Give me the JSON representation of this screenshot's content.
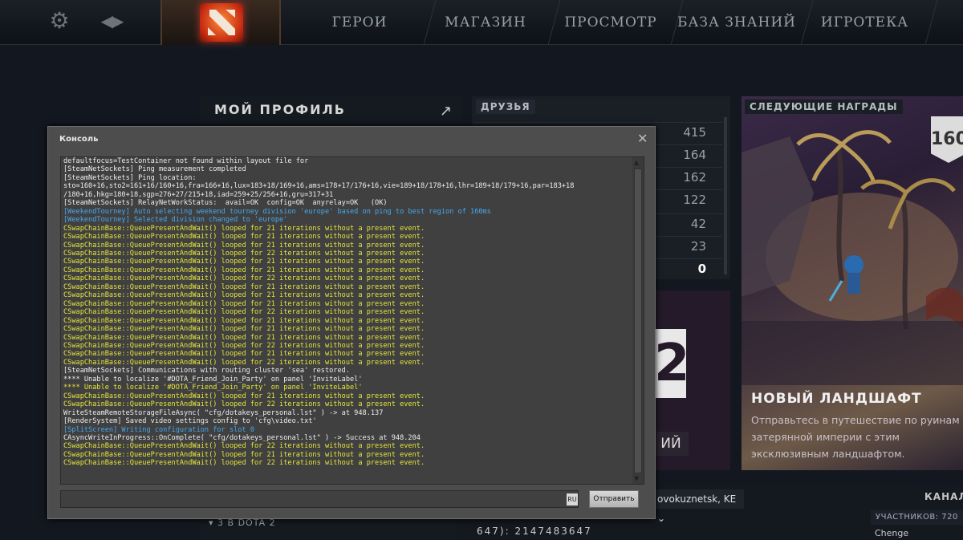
{
  "nav": {
    "tabs": [
      "ГЕРОИ",
      "МАГАЗИН",
      "ПРОСМОТР",
      "БАЗА ЗНАНИЙ",
      "ИГРОТЕКА"
    ]
  },
  "profile": {
    "title": "МОЙ ПРОФИЛЬ",
    "dota_count": "3 В DOTA 2"
  },
  "friends": {
    "label": "ДРУЗЬЯ",
    "counts": [
      "415",
      "164",
      "162",
      "122",
      "42",
      "23",
      "0"
    ]
  },
  "middle": {
    "big_number": "2",
    "button_text": "ИЙ"
  },
  "rewards": {
    "label": "СЛЕДУЮЩИЕ НАГРАДЫ",
    "level": "160",
    "title": "НОВЫЙ ЛАНДШАФТ",
    "description": "Отправьтесь в путешествие по руинам затерянной империи с этим эксклюзивным ландшафтом."
  },
  "bottom": {
    "region": "ovokuznetsk, KE",
    "channels": "КАНАЛЬ",
    "members": "УЧАСТНИКОВ: 720",
    "member_name": "Chenge",
    "lobby_id": "647): 2147483647"
  },
  "console": {
    "title": "Консоль",
    "close": "✕",
    "input_value": "",
    "lang": "RU",
    "send_label": "Отправить",
    "lines": [
      {
        "c": "white",
        "t": "defaultfocus=TestContainer not found within layout file for"
      },
      {
        "c": "white",
        "t": "[SteamNetSockets] Ping measurement completed"
      },
      {
        "c": "white",
        "t": "[SteamNetSockets] Ping location:"
      },
      {
        "c": "white",
        "t": "sto=160+16,sto2=161+16/160+16,fra=166+16,lux=183+18/169+16,ams=178+17/176+16,vie=189+18/178+16,lhr=189+18/179+16,par=183+18"
      },
      {
        "c": "white",
        "t": "/180+16,hkg=180+18,sgp=276+27/215+18,iad=259+25/256+16,gru=317+31"
      },
      {
        "c": "white",
        "t": "[SteamNetSockets] RelayNetWorkStatus:  avail=OK  config=OK  anyrelay=OK   (OK)"
      },
      {
        "c": "cyan",
        "t": "[WeekendTourney] Auto selecting weekend tourney division 'europe' based on ping to best region of 160ms"
      },
      {
        "c": "cyan",
        "t": "[WeekendTourney] Selected division changed to 'europe'"
      },
      {
        "c": "yellow",
        "t": "CSwapChainBase::QueuePresentAndWait() looped for 21 iterations without a present event."
      },
      {
        "c": "yellow",
        "t": "CSwapChainBase::QueuePresentAndWait() looped for 21 iterations without a present event."
      },
      {
        "c": "yellow",
        "t": "CSwapChainBase::QueuePresentAndWait() looped for 21 iterations without a present event."
      },
      {
        "c": "yellow",
        "t": "CSwapChainBase::QueuePresentAndWait() looped for 22 iterations without a present event."
      },
      {
        "c": "yellow",
        "t": "CSwapChainBase::QueuePresentAndWait() looped for 21 iterations without a present event."
      },
      {
        "c": "yellow",
        "t": "CSwapChainBase::QueuePresentAndWait() looped for 21 iterations without a present event."
      },
      {
        "c": "yellow",
        "t": "CSwapChainBase::QueuePresentAndWait() looped for 22 iterations without a present event."
      },
      {
        "c": "yellow",
        "t": "CSwapChainBase::QueuePresentAndWait() looped for 21 iterations without a present event."
      },
      {
        "c": "yellow",
        "t": "CSwapChainBase::QueuePresentAndWait() looped for 21 iterations without a present event."
      },
      {
        "c": "yellow",
        "t": "CSwapChainBase::QueuePresentAndWait() looped for 21 iterations without a present event."
      },
      {
        "c": "yellow",
        "t": "CSwapChainBase::QueuePresentAndWait() looped for 22 iterations without a present event."
      },
      {
        "c": "yellow",
        "t": "CSwapChainBase::QueuePresentAndWait() looped for 21 iterations without a present event."
      },
      {
        "c": "yellow",
        "t": "CSwapChainBase::QueuePresentAndWait() looped for 21 iterations without a present event."
      },
      {
        "c": "yellow",
        "t": "CSwapChainBase::QueuePresentAndWait() looped for 21 iterations without a present event."
      },
      {
        "c": "yellow",
        "t": "CSwapChainBase::QueuePresentAndWait() looped for 22 iterations without a present event."
      },
      {
        "c": "yellow",
        "t": "CSwapChainBase::QueuePresentAndWait() looped for 21 iterations without a present event."
      },
      {
        "c": "yellow",
        "t": "CSwapChainBase::QueuePresentAndWait() looped for 22 iterations without a present event."
      },
      {
        "c": "white",
        "t": "[SteamNetSockets] Communications with routing cluster 'sea' restored."
      },
      {
        "c": "white",
        "t": "**** Unable to localize '#DOTA_Friend_Join_Party' on panel 'InviteLabel'"
      },
      {
        "c": "yellow",
        "t": "**** Unable to localize '#DOTA_Friend_Join_Party' on panel 'InviteLabel'"
      },
      {
        "c": "yellow",
        "t": "CSwapChainBase::QueuePresentAndWait() looped for 21 iterations without a present event."
      },
      {
        "c": "yellow",
        "t": "CSwapChainBase::QueuePresentAndWait() looped for 22 iterations without a present event."
      },
      {
        "c": "white",
        "t": "WriteSteamRemoteStorageFileAsync( \"cfg/dotakeys_personal.lst\" ) -> at 948.137"
      },
      {
        "c": "white",
        "t": "[RenderSystem] Saved video settings config to 'cfg\\video.txt'"
      },
      {
        "c": "cyan",
        "t": "[SplitScreen] Writing configuration for slot 0"
      },
      {
        "c": "white",
        "t": "CAsyncWriteInProgress::OnComplete( \"cfg/dotakeys_personal.lst\" ) -> Success at 948.204"
      },
      {
        "c": "yellow",
        "t": "CSwapChainBase::QueuePresentAndWait() looped for 22 iterations without a present event."
      },
      {
        "c": "yellow",
        "t": "CSwapChainBase::QueuePresentAndWait() looped for 21 iterations without a present event."
      },
      {
        "c": "yellow",
        "t": "CSwapChainBase::QueuePresentAndWait() looped for 22 iterations without a present event."
      }
    ]
  }
}
